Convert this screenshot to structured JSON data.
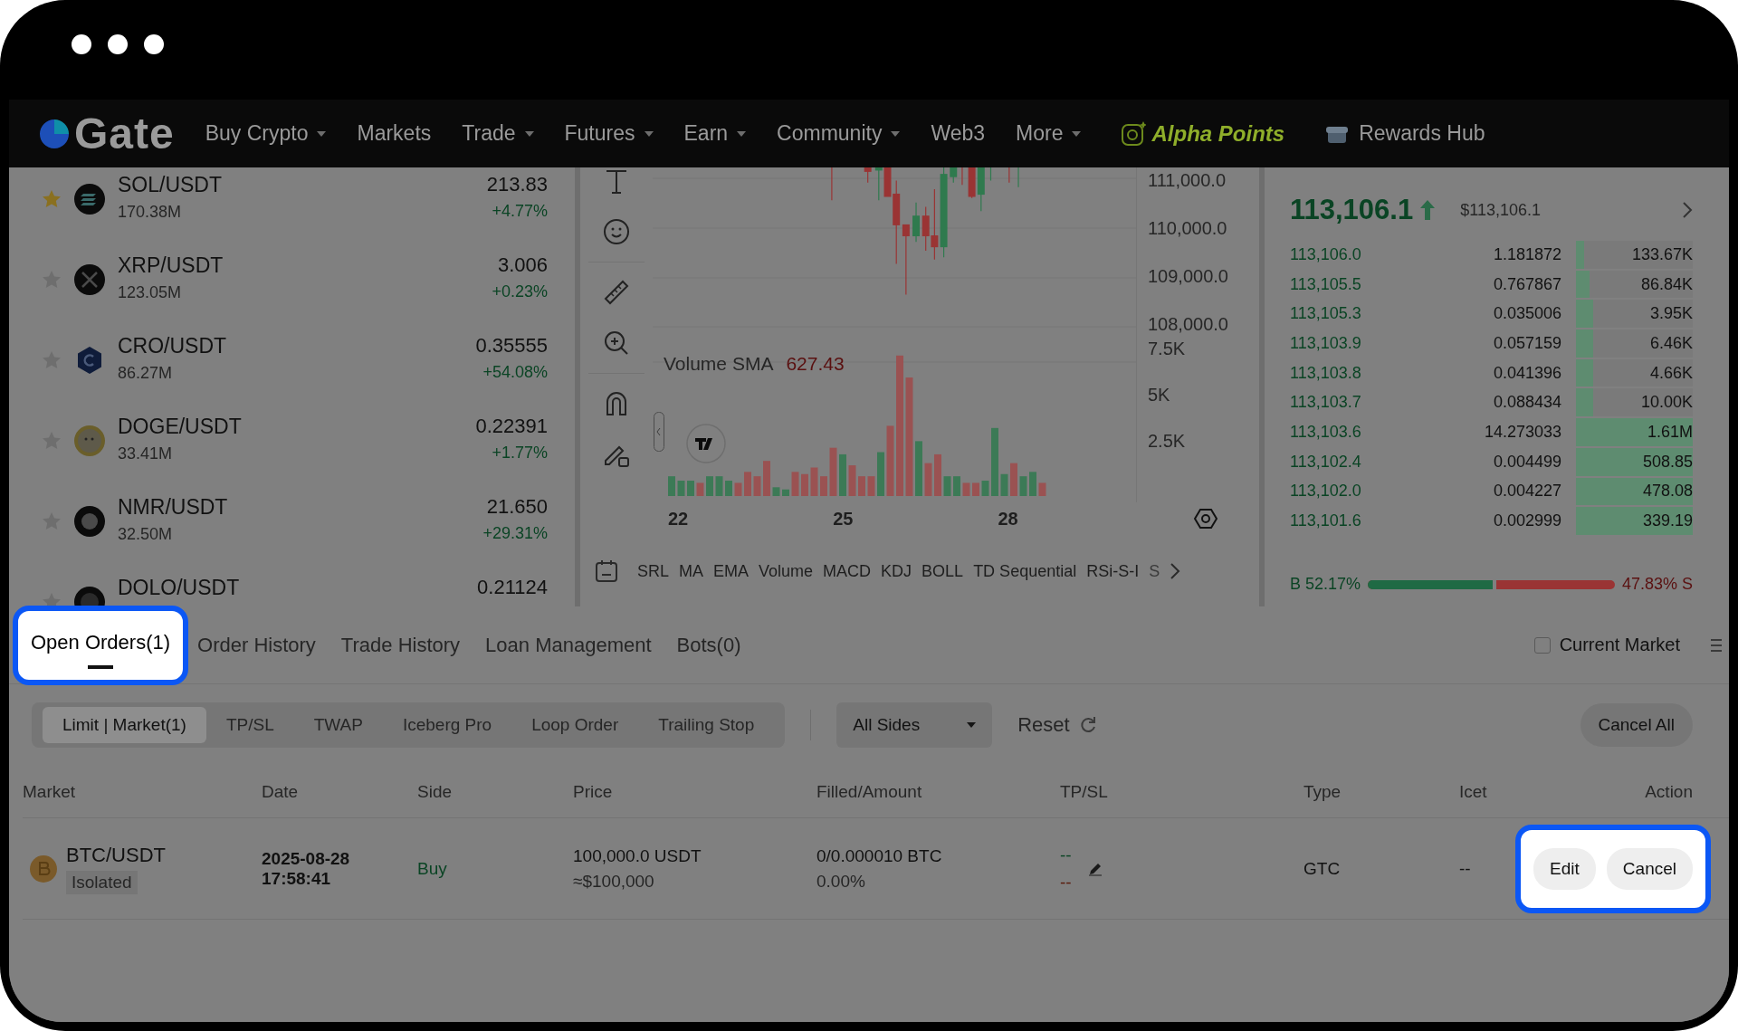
{
  "nav": {
    "logo": "Gate",
    "items": [
      {
        "label": "Buy Crypto",
        "dropdown": true
      },
      {
        "label": "Markets",
        "dropdown": false
      },
      {
        "label": "Trade",
        "dropdown": true
      },
      {
        "label": "Futures",
        "dropdown": true
      },
      {
        "label": "Earn",
        "dropdown": true
      },
      {
        "label": "Community",
        "dropdown": true
      },
      {
        "label": "Web3",
        "dropdown": false
      },
      {
        "label": "More",
        "dropdown": true
      }
    ],
    "promo": "Alpha Points",
    "rewards": "Rewards Hub"
  },
  "markets": [
    {
      "kind": "sol",
      "pair": "SOL/USDT",
      "volume": "170.38M",
      "price": "213.83",
      "change": "+4.77%",
      "favorite": true
    },
    {
      "kind": "xrp",
      "pair": "XRP/USDT",
      "volume": "123.05M",
      "price": "3.006",
      "change": "+0.23%",
      "favorite": false
    },
    {
      "kind": "cro",
      "pair": "CRO/USDT",
      "volume": "86.27M",
      "price": "0.35555",
      "change": "+54.08%",
      "favorite": false
    },
    {
      "kind": "doge",
      "pair": "DOGE/USDT",
      "volume": "33.41M",
      "price": "0.22391",
      "change": "+1.77%",
      "favorite": false
    },
    {
      "kind": "nmr",
      "pair": "NMR/USDT",
      "volume": "32.50M",
      "price": "21.650",
      "change": "+29.31%",
      "favorite": false
    },
    {
      "kind": "dolo",
      "pair": "DOLO/USDT",
      "price": "0.21124",
      "favorite": false
    }
  ],
  "chart": {
    "price_axis": [
      "111,000.0",
      "110,000.0",
      "109,000.0",
      "108,000.0"
    ],
    "volume_axis": [
      "7.5K",
      "5K",
      "2.5K"
    ],
    "indicator": {
      "name": "Volume SMA",
      "value": "627.43"
    },
    "dates": [
      "22",
      "25",
      "28"
    ],
    "indicators": [
      "SRL",
      "MA",
      "EMA",
      "Volume",
      "MACD",
      "KDJ",
      "BOLL",
      "TD Sequential",
      "RSi-S-I",
      "S"
    ]
  },
  "orderbook": {
    "last_price": "113,106.1",
    "usd_price": "$113,106.1",
    "bids": [
      {
        "price": "113,106.0",
        "amount": "1.181872",
        "total": "133.67K",
        "level": 0.07
      },
      {
        "price": "113,105.5",
        "amount": "0.767867",
        "total": "86.84K",
        "level": 0.12
      },
      {
        "price": "113,105.3",
        "amount": "0.035006",
        "total": "3.95K",
        "level": 0.15
      },
      {
        "price": "113,103.9",
        "amount": "0.057159",
        "total": "6.46K",
        "level": 0.15
      },
      {
        "price": "113,103.8",
        "amount": "0.041396",
        "total": "4.66K",
        "level": 0.15
      },
      {
        "price": "113,103.7",
        "amount": "0.088434",
        "total": "10.00K",
        "level": 0.15
      },
      {
        "price": "113,103.6",
        "amount": "14.273033",
        "total": "1.61M",
        "level": 1
      },
      {
        "price": "113,102.4",
        "amount": "0.004499",
        "total": "508.85",
        "level": 1
      },
      {
        "price": "113,102.0",
        "amount": "0.004227",
        "total": "478.08",
        "level": 1
      },
      {
        "price": "113,101.6",
        "amount": "0.002999",
        "total": "339.19",
        "level": 1
      }
    ],
    "ratio": {
      "buy_label": "B 52.17%",
      "sell_label": "47.83% S",
      "level": 0.5217
    }
  },
  "orders": {
    "tabs": [
      {
        "label": "Open Orders(1)",
        "selected": true,
        "highlighted": true
      },
      {
        "label": "Order History",
        "selected": false,
        "highlighted": false
      },
      {
        "label": "Trade History",
        "selected": false,
        "highlighted": false
      },
      {
        "label": "Loan Management",
        "selected": false,
        "highlighted": false
      },
      {
        "label": "Bots(0)",
        "selected": false,
        "highlighted": false
      }
    ],
    "current_market": {
      "label": "Current Market",
      "checked": false
    },
    "subtabs": [
      {
        "label": "Limit | Market(1)",
        "selected": true
      },
      {
        "label": "TP/SL",
        "selected": false
      },
      {
        "label": "TWAP",
        "selected": false
      },
      {
        "label": "Iceberg Pro",
        "selected": false
      },
      {
        "label": "Loop Order",
        "selected": false
      },
      {
        "label": "Trailing Stop",
        "selected": false
      }
    ],
    "side_filter": "All Sides",
    "reset": "Reset",
    "cancel_all": "Cancel All",
    "columns": [
      "Market",
      "Date",
      "Side",
      "Price",
      "Filled/Amount",
      "TP/SL",
      "Type",
      "Icet",
      "Action"
    ],
    "rows": [
      {
        "market": "BTC/USDT",
        "margin": "Isolated",
        "date": "2025-08-28",
        "time": "17:58:41",
        "side": "Buy",
        "price": "100,000.0 USDT",
        "price_usd": "≈$100,000",
        "filled": "0/0.000010 BTC",
        "filled_pct": "0.00%",
        "tp": "--",
        "sl": "--",
        "type": "GTC",
        "iceberg": "--",
        "actions_highlighted": true,
        "actions": [
          "Edit",
          "Cancel"
        ]
      }
    ]
  }
}
